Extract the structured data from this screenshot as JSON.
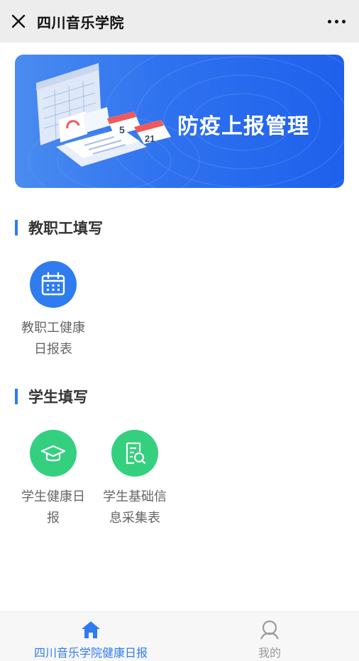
{
  "header": {
    "title": "四川音乐学院"
  },
  "banner": {
    "title": "防疫上报管理",
    "date_tiles": [
      "5",
      "21"
    ]
  },
  "sections": [
    {
      "title": "教职工填写",
      "items": [
        {
          "label": "教职工健康日报表",
          "icon": "calendar-icon",
          "color": "#2f7cf0"
        }
      ]
    },
    {
      "title": "学生填写",
      "items": [
        {
          "label": "学生健康日报",
          "icon": "graduation-cap-icon",
          "color": "#35d07f"
        },
        {
          "label": "学生基础信息采集表",
          "icon": "document-search-icon",
          "color": "#35d07f"
        }
      ]
    }
  ],
  "tabbar": {
    "tabs": [
      {
        "label": "四川音乐学院健康日报",
        "icon": "home-icon",
        "active": true
      },
      {
        "label": "我的",
        "icon": "user-icon",
        "active": false
      }
    ],
    "active_color": "#2f7cf0"
  }
}
